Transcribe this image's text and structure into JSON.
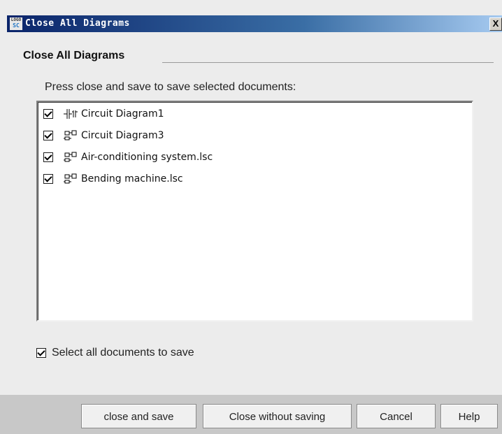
{
  "window": {
    "title": "Close All Diagrams",
    "icon_text_top": "LOGO",
    "icon_text_bottom": "SC",
    "close_label": "X"
  },
  "section_title": "Close All Diagrams",
  "instruction": "Press close and save to save selected documents:",
  "documents": [
    {
      "label": "Circuit Diagram1",
      "checked": true,
      "icon": "circuit-diagram-icon"
    },
    {
      "label": "Circuit Diagram3",
      "checked": true,
      "icon": "function-block-diagram-icon"
    },
    {
      "label": "Air-conditioning system.lsc",
      "checked": true,
      "icon": "function-block-diagram-icon"
    },
    {
      "label": "Bending machine.lsc",
      "checked": true,
      "icon": "function-block-diagram-icon"
    }
  ],
  "select_all": {
    "label": "Select all documents to save",
    "checked": true
  },
  "buttons": {
    "close_and_save": "close and save",
    "close_without_saving": "Close without saving",
    "cancel": "Cancel",
    "help": "Help"
  }
}
